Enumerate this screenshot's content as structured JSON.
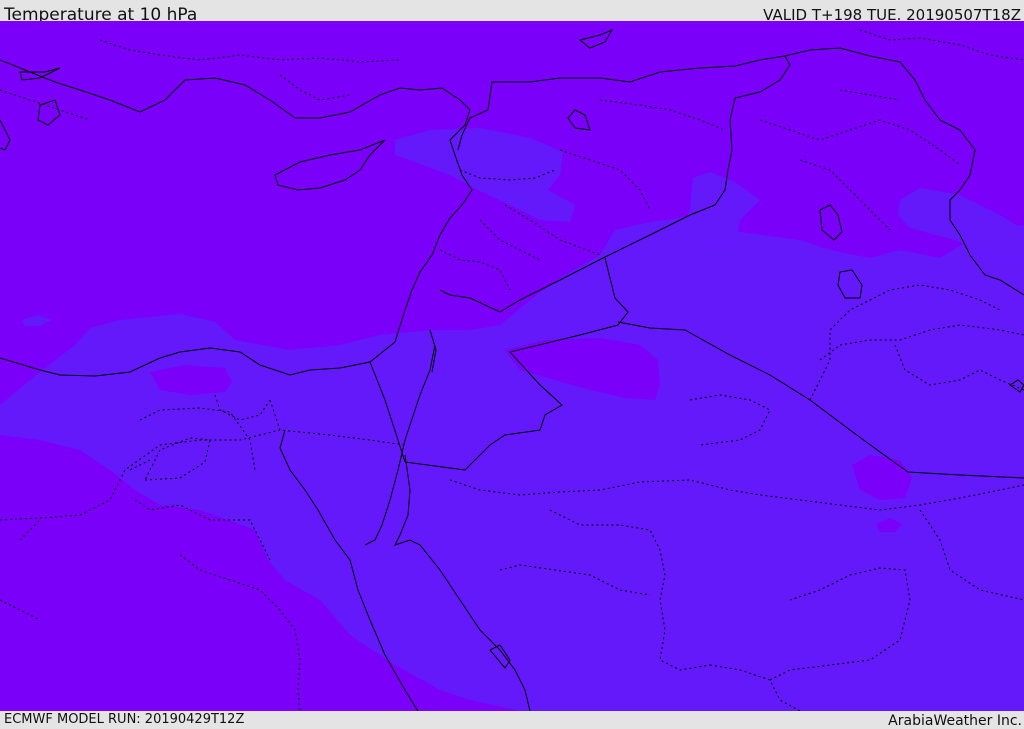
{
  "header": {
    "title": "Temperature at 10 hPa",
    "valid": "VALID T+198 TUE. 20190507T18Z"
  },
  "footer": {
    "model_run": "ECMWF MODEL RUN: 20190429T12Z",
    "credit": "ArabiaWeather Inc."
  },
  "map": {
    "colors": {
      "cold_band": "#7a00fa",
      "warm_band": "#6419fb",
      "coastline": "#000000",
      "country_border": "#000000"
    }
  }
}
